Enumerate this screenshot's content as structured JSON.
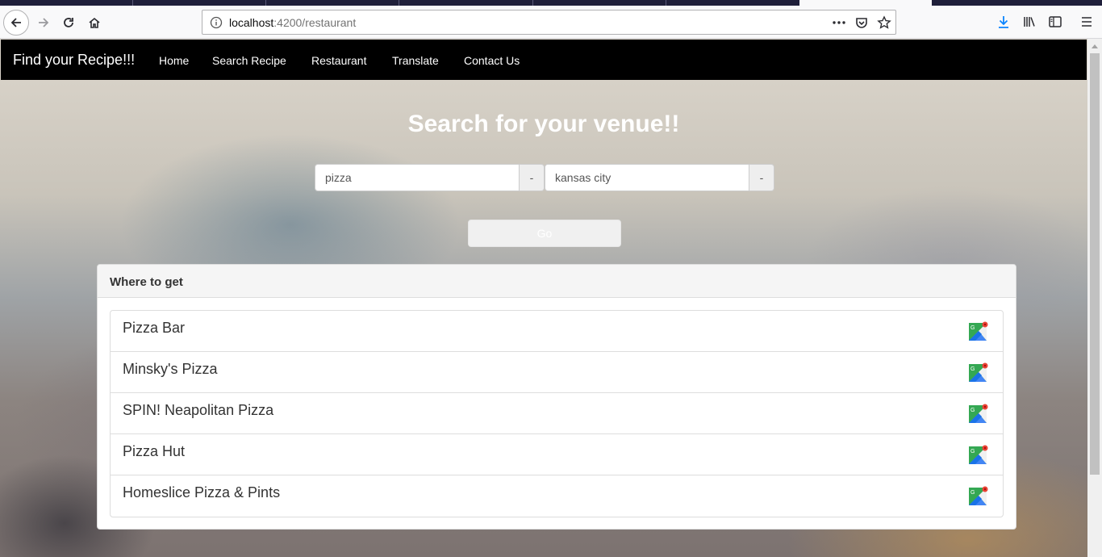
{
  "browser": {
    "url_host": "localhost",
    "url_path": ":4200/restaurant"
  },
  "navbar": {
    "brand": "Find your Recipe!!!",
    "links": [
      "Home",
      "Search Recipe",
      "Restaurant",
      "Translate",
      "Contact Us"
    ]
  },
  "search": {
    "heading": "Search for your venue!!",
    "query_value": "pizza",
    "query_addon": "-",
    "location_value": "kansas city",
    "location_addon": "-",
    "go_label": "Go"
  },
  "results": {
    "panel_title": "Where to get",
    "items": [
      {
        "name": "Pizza Bar",
        "icon": "google-maps-icon"
      },
      {
        "name": "Minsky's Pizza",
        "icon": "google-maps-icon"
      },
      {
        "name": "SPIN! Neapolitan Pizza",
        "icon": "google-maps-icon"
      },
      {
        "name": "Pizza Hut",
        "icon": "google-maps-icon"
      },
      {
        "name": "Homeslice Pizza & Pints",
        "icon": "google-maps-icon"
      }
    ]
  },
  "colors": {
    "navbar_bg": "#000000",
    "heading": "#ffffff",
    "download_icon": "#0a84ff"
  }
}
